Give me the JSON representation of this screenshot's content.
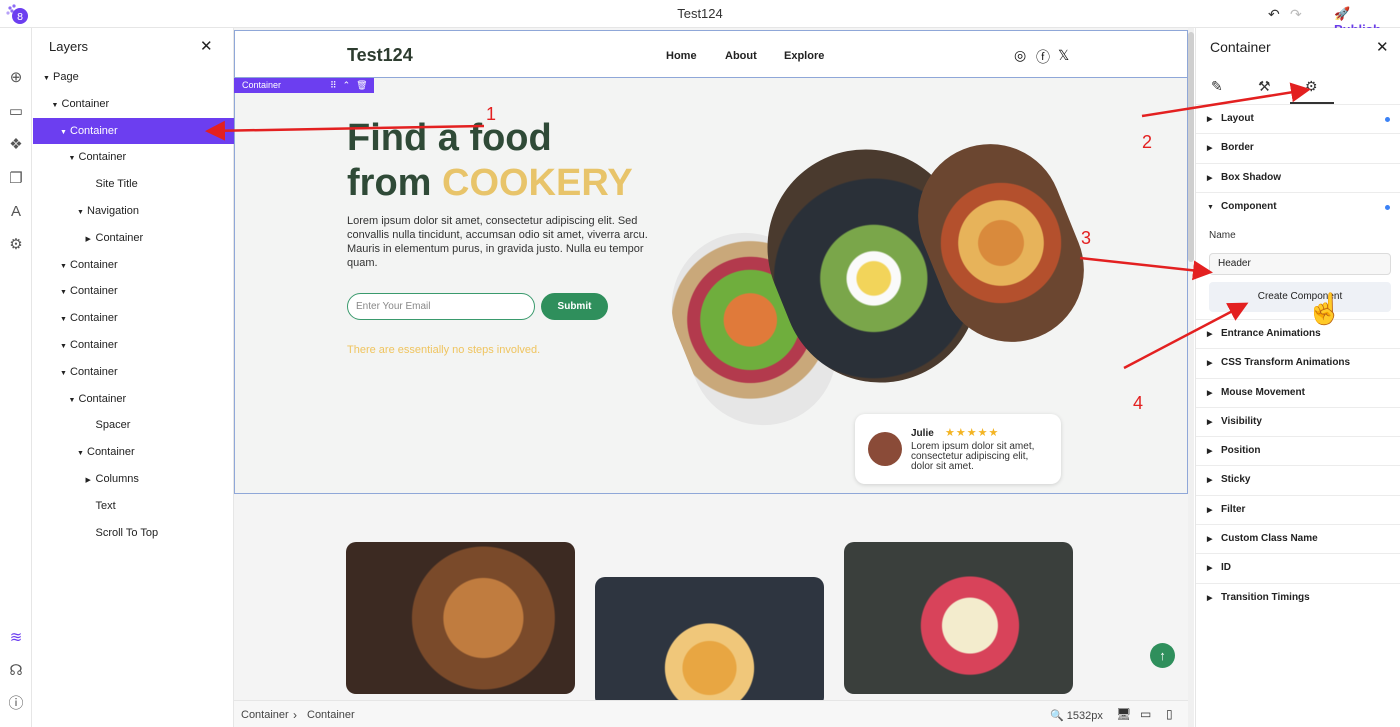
{
  "app": {
    "title": "Test124",
    "publish_label": "Publish"
  },
  "layers_panel": {
    "title": "Layers",
    "items": [
      {
        "label": "Page",
        "depth": 0,
        "caret": true
      },
      {
        "label": "Container",
        "depth": 1,
        "caret": true
      },
      {
        "label": "Container",
        "depth": 2,
        "caret": true,
        "selected": true
      },
      {
        "label": "Container",
        "depth": 3,
        "caret": true
      },
      {
        "label": "Site Title",
        "depth": 5,
        "caret": false
      },
      {
        "label": "Navigation",
        "depth": 4,
        "caret": true
      },
      {
        "label": "Container",
        "depth": 5,
        "caret": true
      },
      {
        "label": "Container",
        "depth": 2,
        "caret": true
      },
      {
        "label": "Container",
        "depth": 2,
        "caret": true
      },
      {
        "label": "Container",
        "depth": 2,
        "caret": true
      },
      {
        "label": "Container",
        "depth": 2,
        "caret": true
      },
      {
        "label": "Container",
        "depth": 2,
        "caret": true
      },
      {
        "label": "Container",
        "depth": 3,
        "caret": true
      },
      {
        "label": "Spacer",
        "depth": 5,
        "caret": false
      },
      {
        "label": "Container",
        "depth": 4,
        "caret": true
      },
      {
        "label": "Columns",
        "depth": 5,
        "caret": true
      },
      {
        "label": "Text",
        "depth": 5,
        "caret": false
      },
      {
        "label": "Scroll To Top",
        "depth": 5,
        "caret": false
      }
    ]
  },
  "site": {
    "title": "Test124",
    "nav": [
      "Home",
      "About",
      "Explore"
    ],
    "container_label": "Container",
    "hero": {
      "heading_line1": "Find a food",
      "heading_from": "from ",
      "heading_accent": "COOKERY",
      "paragraph": "Lorem ipsum dolor sit amet, consectetur adipiscing elit. Sed convallis nulla tincidunt, accumsan odio sit amet, viverra arcu. Mauris in elementum purus, in gravida justo. Nulla eu tempor quam.",
      "email_placeholder": "Enter Your Email",
      "submit_label": "Submit",
      "note": "There are essentially no steps involved."
    },
    "review": {
      "name": "Julie",
      "stars": "★★★★★",
      "text": "Lorem ipsum dolor sit amet, consectetur adipiscing elit, dolor sit amet."
    }
  },
  "bottom_bar": {
    "breadcrumb": [
      "Container",
      "Container"
    ],
    "zoom": "1532px"
  },
  "props_panel": {
    "title": "Container",
    "sections": [
      {
        "label": "Layout",
        "dot": true,
        "open": false
      },
      {
        "label": "Border",
        "dot": false,
        "open": false
      },
      {
        "label": "Box Shadow",
        "dot": false,
        "open": false
      },
      {
        "label": "Component",
        "dot": true,
        "open": true
      },
      {
        "label": "Entrance Animations",
        "dot": false,
        "open": false
      },
      {
        "label": "CSS Transform Animations",
        "dot": false,
        "open": false
      },
      {
        "label": "Mouse Movement",
        "dot": false,
        "open": false
      },
      {
        "label": "Visibility",
        "dot": false,
        "open": false
      },
      {
        "label": "Position",
        "dot": false,
        "open": false
      },
      {
        "label": "Sticky",
        "dot": false,
        "open": false
      },
      {
        "label": "Filter",
        "dot": false,
        "open": false
      },
      {
        "label": "Custom Class Name",
        "dot": false,
        "open": false
      },
      {
        "label": "ID",
        "dot": false,
        "open": false
      },
      {
        "label": "Transition Timings",
        "dot": false,
        "open": false
      }
    ],
    "component": {
      "name_label": "Name",
      "name_value": "Header",
      "create_label": "Create Component"
    }
  },
  "annotations": [
    "1",
    "2",
    "3",
    "4"
  ],
  "colors": {
    "accent": "#6c3ef0",
    "green": "#2f8f5c",
    "gold": "#e8c46a",
    "annotation": "#e32020"
  }
}
